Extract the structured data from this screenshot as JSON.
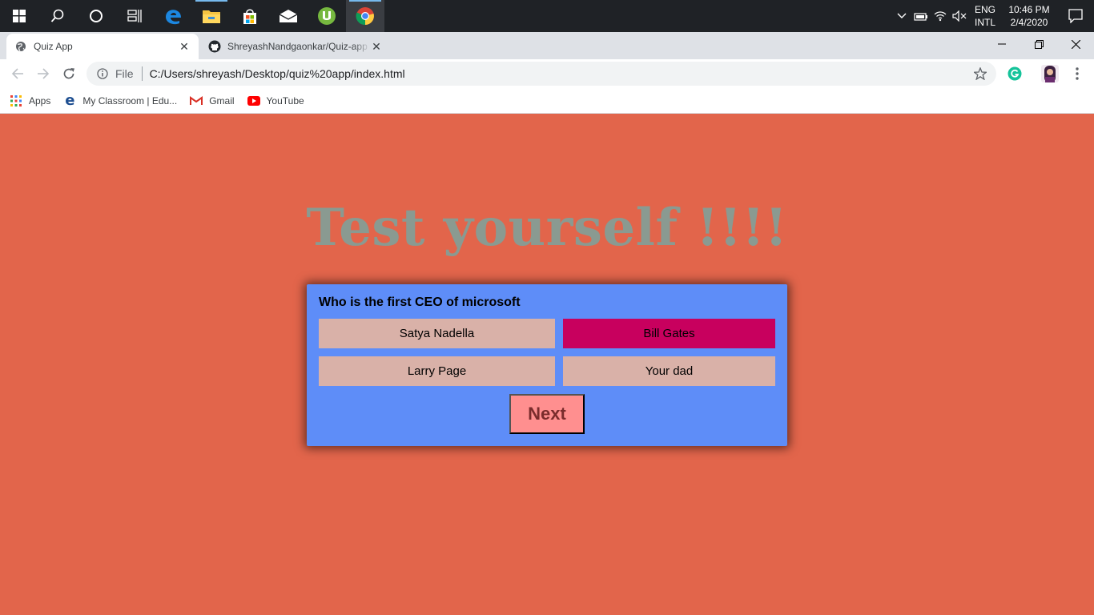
{
  "taskbar": {
    "apps": [
      "windows-start",
      "search",
      "cortana",
      "task-view",
      "edge",
      "file-explorer",
      "store",
      "mail",
      "utorrent",
      "chrome"
    ],
    "tray": {
      "lang_line1": "ENG",
      "lang_line2": "INTL",
      "time": "10:46 PM",
      "date": "2/4/2020"
    }
  },
  "browser": {
    "tabs": [
      {
        "title": "Quiz App",
        "active": true
      },
      {
        "title": "ShreyashNandgaonkar/Quiz-app",
        "active": false
      }
    ],
    "address": {
      "scheme_label": "File",
      "url": "C:/Users/shreyash/Desktop/quiz%20app/index.html"
    },
    "bookmarks": [
      "Apps",
      "My Classroom | Edu...",
      "Gmail",
      "YouTube"
    ]
  },
  "page": {
    "heading": "Test yourself !!!!",
    "quiz": {
      "question": "Who is the first CEO of microsoft",
      "answers": [
        {
          "label": "Satya Nadella",
          "selected": false
        },
        {
          "label": "Bill Gates",
          "selected": true
        },
        {
          "label": "Larry Page",
          "selected": false
        },
        {
          "label": "Your dad",
          "selected": false
        }
      ],
      "next_label": "Next"
    }
  },
  "colors": {
    "page_background": "#e2654b",
    "heading": "#8a9a91",
    "quiz_card": "#5e8df8",
    "answer": "#d9b1a8",
    "answer_selected": "#c8005e",
    "next_button": "#ff8f8f",
    "next_text": "#7a2c2c"
  }
}
